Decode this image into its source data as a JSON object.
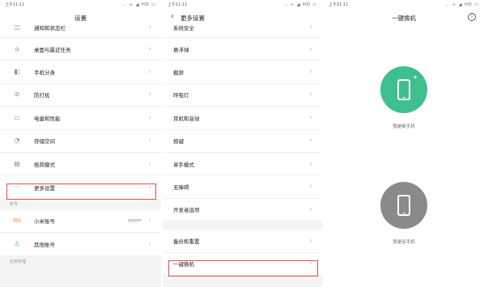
{
  "statusbar": {
    "time": "上午11:11",
    "icons": "… ≈ ◢ HD ▭"
  },
  "settings": {
    "title": "设置",
    "rows": [
      {
        "icon": "bell-icon",
        "glyph": "◫",
        "label": "通知和状态栏"
      },
      {
        "icon": "home-icon",
        "glyph": "⌂",
        "label": "桌面与最近任务"
      },
      {
        "icon": "dual-apps-icon",
        "glyph": "◧",
        "label": "手机分身"
      },
      {
        "icon": "do-not-disturb-icon",
        "glyph": "⊘",
        "label": "防打扰"
      },
      {
        "icon": "battery-icon",
        "glyph": "▭",
        "label": "电量和性能"
      },
      {
        "icon": "storage-icon",
        "glyph": "◔",
        "label": "存储空间"
      },
      {
        "icon": "simple-mode-icon",
        "glyph": "▤",
        "label": "极简模式"
      },
      {
        "icon": "more-icon",
        "glyph": "···",
        "label": "更多设置"
      }
    ],
    "account_header": "账号",
    "accounts": [
      {
        "icon": "mi-logo-icon",
        "glyph": "mi",
        "label": "小米账号",
        "value": "jasper"
      },
      {
        "icon": "person-icon",
        "glyph": "♙",
        "label": "其他账号"
      }
    ],
    "apps_header": "应用管理"
  },
  "more_settings": {
    "title": "更多设置",
    "rows": [
      "系统安全",
      "悬浮球",
      "截屏",
      "呼吸灯",
      "耳机和音效",
      "按键",
      "单手模式",
      "无障碍",
      "开发者选项",
      "备份和重置",
      "一键换机"
    ]
  },
  "mi_mover": {
    "title": "一键换机",
    "new_phone_label": "我是新手机",
    "old_phone_label": "我是旧手机"
  },
  "colors": {
    "new_phone": "#3fbf8f",
    "old_phone": "#8a8a8a",
    "highlight": "#d9534f"
  }
}
